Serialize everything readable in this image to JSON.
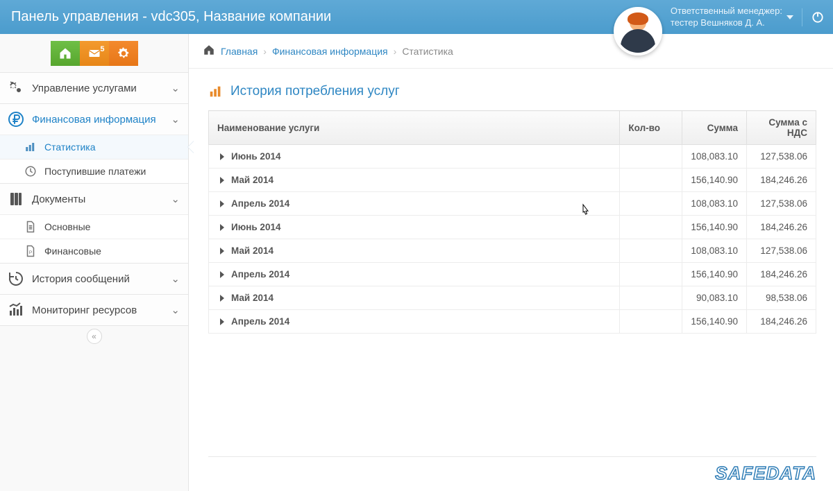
{
  "header": {
    "title": "Панель управления - vdc305, Название компании",
    "manager_label": "Ответственный менеджер:",
    "manager_name": "тестер Вешняков Д. А.",
    "mail_badge": "5"
  },
  "sidebar": {
    "sections": [
      {
        "id": "services",
        "label": "Управление услугами"
      },
      {
        "id": "finance",
        "label": "Финансовая информация"
      },
      {
        "id": "docs",
        "label": "Документы"
      },
      {
        "id": "messages",
        "label": "История сообщений"
      },
      {
        "id": "monitor",
        "label": "Мониторинг ресурсов"
      }
    ],
    "finance_children": [
      {
        "id": "stat",
        "label": "Статистика"
      },
      {
        "id": "payments",
        "label": "Поступившие платежи"
      }
    ],
    "docs_children": [
      {
        "id": "main",
        "label": "Основные"
      },
      {
        "id": "fin",
        "label": "Финансовые"
      }
    ]
  },
  "breadcrumb": {
    "home": "Главная",
    "l1": "Финансовая информация",
    "l2": "Статистика"
  },
  "page_title": "История потребления услуг",
  "table": {
    "columns": {
      "name": "Наименование услуги",
      "qty": "Кол-во",
      "sum": "Сумма",
      "sum_vat": "Сумма с НДС"
    },
    "rows": [
      {
        "name": "Июнь 2014",
        "qty": "",
        "sum": "108,083.10",
        "sum_vat": "127,538.06"
      },
      {
        "name": "Май 2014",
        "qty": "",
        "sum": "156,140.90",
        "sum_vat": "184,246.26"
      },
      {
        "name": "Апрель 2014",
        "qty": "",
        "sum": "108,083.10",
        "sum_vat": "127,538.06"
      },
      {
        "name": "Июнь 2014",
        "qty": "",
        "sum": "156,140.90",
        "sum_vat": "184,246.26"
      },
      {
        "name": "Май 2014",
        "qty": "",
        "sum": "108,083.10",
        "sum_vat": "127,538.06"
      },
      {
        "name": "Апрель 2014",
        "qty": "",
        "sum": "156,140.90",
        "sum_vat": "184,246.26"
      },
      {
        "name": "Май 2014",
        "qty": "",
        "sum": "90,083.10",
        "sum_vat": "98,538.06"
      },
      {
        "name": "Апрель 2014",
        "qty": "",
        "sum": "156,140.90",
        "sum_vat": "184,246.26"
      }
    ]
  },
  "footer_logo": "SAFEDATA"
}
